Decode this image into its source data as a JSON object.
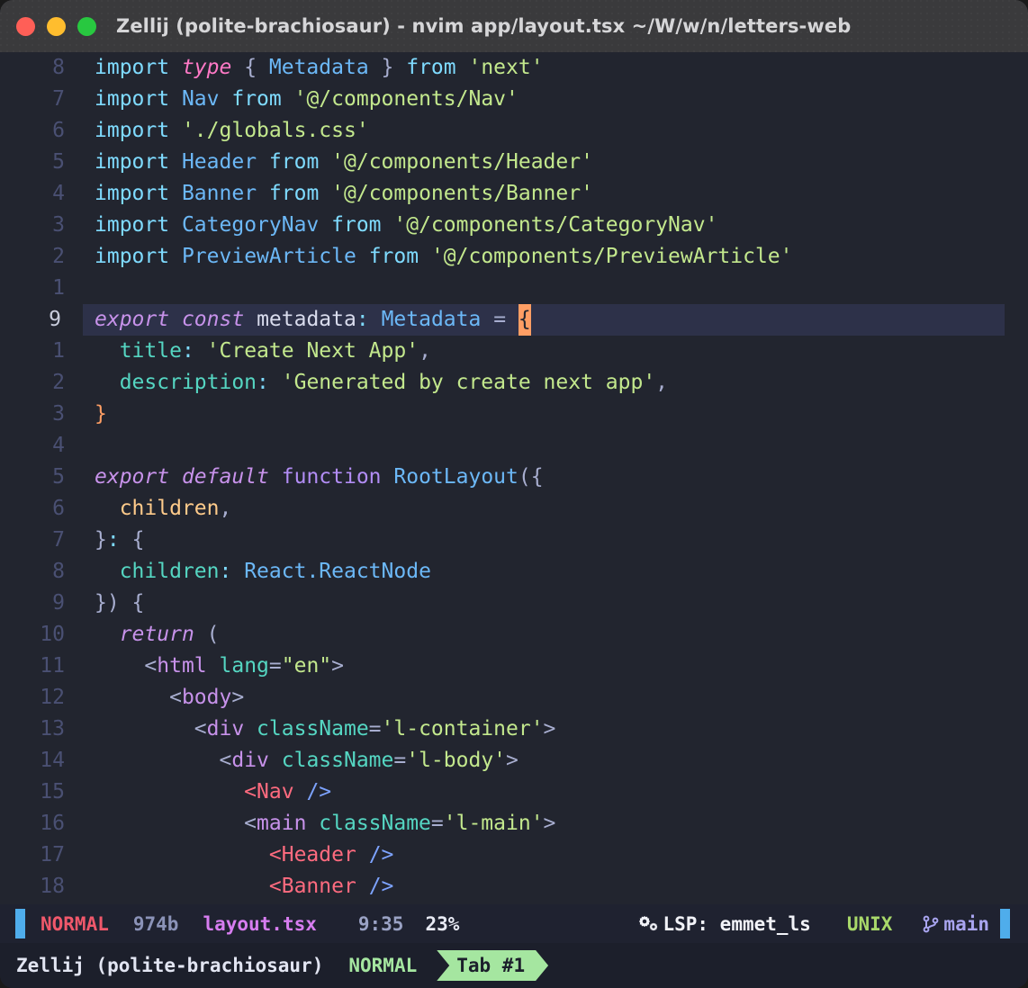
{
  "window": {
    "title": "Zellij (polite-brachiosaur) - nvim app/layout.tsx ~/W/w/n/letters-web",
    "traffic_lights": [
      {
        "name": "close",
        "color": "#ff5f57"
      },
      {
        "name": "minimize",
        "color": "#ffbd2e"
      },
      {
        "name": "maximize",
        "color": "#28c840"
      }
    ]
  },
  "editor": {
    "filetype": "tsx",
    "lines": [
      {
        "num": "8",
        "cursor": false
      },
      {
        "num": "7",
        "cursor": false
      },
      {
        "num": "6",
        "cursor": false
      },
      {
        "num": "5",
        "cursor": false
      },
      {
        "num": "4",
        "cursor": false
      },
      {
        "num": "3",
        "cursor": false
      },
      {
        "num": "2",
        "cursor": false
      },
      {
        "num": "1",
        "cursor": false
      },
      {
        "num": "9",
        "cursor": true
      },
      {
        "num": "1",
        "cursor": false
      },
      {
        "num": "2",
        "cursor": false
      },
      {
        "num": "3",
        "cursor": false
      },
      {
        "num": "4",
        "cursor": false
      },
      {
        "num": "5",
        "cursor": false
      },
      {
        "num": "6",
        "cursor": false
      },
      {
        "num": "7",
        "cursor": false
      },
      {
        "num": "8",
        "cursor": false
      },
      {
        "num": "9",
        "cursor": false
      },
      {
        "num": "10",
        "cursor": false
      },
      {
        "num": "11",
        "cursor": false
      },
      {
        "num": "12",
        "cursor": false
      },
      {
        "num": "13",
        "cursor": false
      },
      {
        "num": "14",
        "cursor": false
      },
      {
        "num": "15",
        "cursor": false
      },
      {
        "num": "16",
        "cursor": false
      },
      {
        "num": "17",
        "cursor": false
      },
      {
        "num": "18",
        "cursor": false
      }
    ],
    "text": {
      "l1": "import type { Metadata } from 'next'",
      "l2": "import Nav from '@/components/Nav'",
      "l3": "import './globals.css'",
      "l4": "import Header from '@/components/Header'",
      "l5": "import Banner from '@/components/Banner'",
      "l6": "import CategoryNav from '@/components/CategoryNav'",
      "l7": "import PreviewArticle from '@/components/PreviewArticle'",
      "l8": "",
      "l9": "export const metadata: Metadata = {",
      "l10": "  title: 'Create Next App',",
      "l11": "  description: 'Generated by create next app',",
      "l12": "}",
      "l13": "",
      "l14": "export default function RootLayout({",
      "l15": "  children,",
      "l16": "}: {",
      "l17": "  children: React.ReactNode",
      "l18": "}) {",
      "l19": "  return (",
      "l20": "    <html lang=\"en\">",
      "l21": "      <body>",
      "l22": "        <div className='l-container'>",
      "l23": "          <div className='l-body'>",
      "l24": "            <Nav />",
      "l25": "            <main className='l-main'>",
      "l26": "              <Header />",
      "l27": "              <Banner />"
    },
    "tokens": {
      "import": "import",
      "type": "type",
      "from": "from",
      "export": "export",
      "const": "const",
      "default": "default",
      "function": "function",
      "return": "return",
      "metadata": "metadata",
      "Metadata": "Metadata",
      "Nav": "Nav",
      "Header": "Header",
      "Banner": "Banner",
      "CategoryNav": "CategoryNav",
      "PreviewArticle": "PreviewArticle",
      "RootLayout": "RootLayout",
      "children": "children",
      "ReactNode": "React.ReactNode",
      "title_key": "title",
      "description_key": "description",
      "title_value": "'Create Next App'",
      "description_value": "'Generated by create next app'",
      "next_str": "'next'",
      "nav_str": "'@/components/Nav'",
      "globals_str": "'./globals.css'",
      "header_str": "'@/components/Header'",
      "banner_str": "'@/components/Banner'",
      "categorynav_str": "'@/components/CategoryNav'",
      "previewarticle_str": "'@/components/PreviewArticle'",
      "html_tag": "html",
      "body_tag": "body",
      "div_tag": "div",
      "main_tag": "main",
      "lang_attr": "lang",
      "lang_value": "\"en\"",
      "classname_attr": "className",
      "l_container": "'l-container'",
      "l_body": "'l-body'",
      "l_main": "'l-main'",
      "cursor_char": "{"
    }
  },
  "statusline": {
    "mode": "NORMAL",
    "filesize": "974b",
    "filename": "layout.tsx",
    "position": "9:35",
    "percent": "23%",
    "lsp_icon": "gears-icon",
    "lsp": "LSP: emmet_ls",
    "fileformat": "UNIX",
    "branch_icon": "git-branch-icon",
    "branch": "main"
  },
  "zellij": {
    "session": "Zellij (polite-brachiosaur)",
    "mode": "NORMAL",
    "tab": "Tab #1"
  }
}
